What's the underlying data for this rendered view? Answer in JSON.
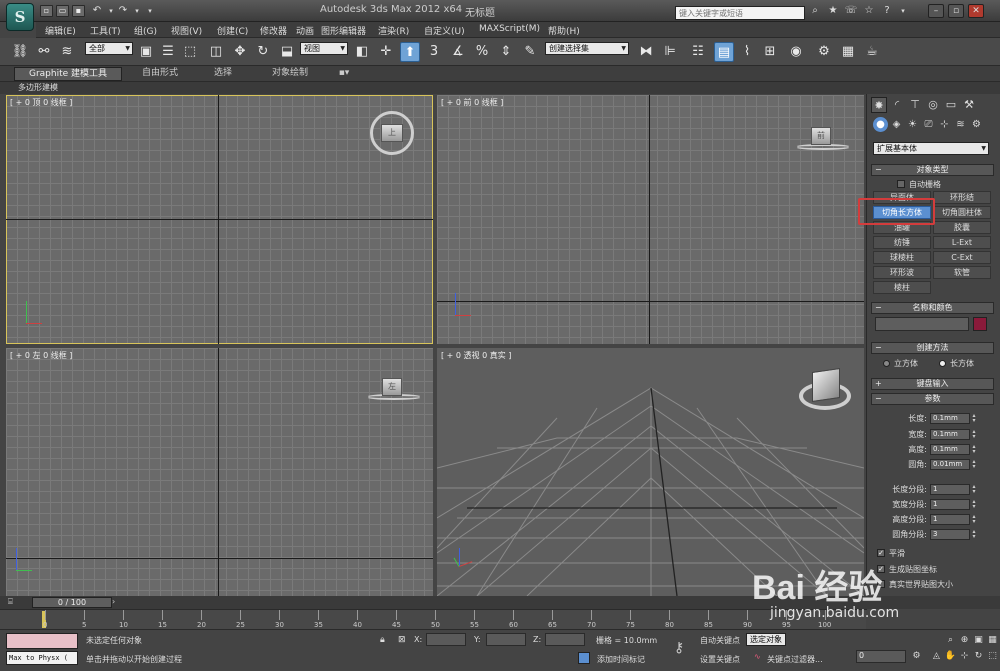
{
  "titlebar": {
    "app_title": "Autodesk 3ds Max  2012 x64",
    "doc_name": "无标题",
    "search_placeholder": "键入关键字或短语",
    "logo_icon": "3dsmax-logo-icon"
  },
  "menubar": {
    "items": [
      "编辑(E)",
      "工具(T)",
      "组(G)",
      "视图(V)",
      "创建(C)",
      "修改器",
      "动画",
      "图形编辑器",
      "渲染(R)",
      "自定义(U)",
      "MAXScript(M)",
      "帮助(H)"
    ]
  },
  "toolbar": {
    "selection_filter": "全部",
    "ref_coord": "视图",
    "snap_label": "3",
    "named_selection": "创建选择集"
  },
  "ribbon": {
    "tabs": [
      "Graphite 建模工具",
      "自由形式",
      "选择",
      "对象绘制"
    ],
    "sub_label": "多边形建模"
  },
  "viewports": {
    "top": {
      "label": "[ + 0 顶 0 线框 ]",
      "cube_label": "上"
    },
    "front": {
      "label": "[ + 0 前 0 线框 ]",
      "cube_label": "前"
    },
    "left": {
      "label": "[ + 0 左 0 线框 ]",
      "cube_label": "左"
    },
    "persp": {
      "label": "[ + 0 透视 0 真实 ]"
    }
  },
  "command_panel": {
    "category": "扩展基本体",
    "object_type": {
      "title": "对象类型",
      "autogrid": "自动栅格",
      "buttons": [
        "异面体",
        "环形结",
        "切角长方体",
        "切角圆柱体",
        "油罐",
        "胶囊",
        "纺锤",
        "L-Ext",
        "球棱柱",
        "C-Ext",
        "环形波",
        "软管",
        "棱柱"
      ],
      "selected": "切角长方体"
    },
    "name_color": {
      "title": "名称和颜色",
      "swatch": "#8a1a3a"
    },
    "creation_method": {
      "title": "创建方法",
      "options": [
        "立方体",
        "长方体"
      ],
      "selected": "长方体"
    },
    "keyboard_entry": {
      "title": "键盘输入"
    },
    "parameters": {
      "title": "参数",
      "fields": [
        {
          "label": "长度:",
          "value": "0.1mm"
        },
        {
          "label": "宽度:",
          "value": "0.1mm"
        },
        {
          "label": "高度:",
          "value": "0.1mm"
        },
        {
          "label": "圆角:",
          "value": "0.01mm"
        }
      ],
      "segs": [
        {
          "label": "长度分段:",
          "value": "1"
        },
        {
          "label": "宽度分段:",
          "value": "1"
        },
        {
          "label": "高度分段:",
          "value": "1"
        },
        {
          "label": "圆角分段:",
          "value": "3"
        }
      ],
      "smooth": "平滑",
      "gen_map": "生成贴图坐标",
      "real_world": "真实世界贴图大小"
    }
  },
  "timeline": {
    "frame": "0 / 100",
    "ticks": [
      "0",
      "5",
      "10",
      "15",
      "20",
      "25",
      "30",
      "35",
      "40",
      "45",
      "50",
      "55",
      "60",
      "65",
      "70",
      "75",
      "80",
      "85",
      "90",
      "95",
      "100"
    ]
  },
  "status": {
    "script_label": "Max to Physx (",
    "selection": "未选定任何对象",
    "prompt": "单击并拖动以开始创建过程",
    "x_label": "X:",
    "y_label": "Y:",
    "z_label": "Z:",
    "grid": "栅格 = 10.0mm",
    "add_time_tag": "添加时间标记",
    "auto_key": "自动关键点",
    "set_key": "设置关键点",
    "selected_dd": "选定对象",
    "key_filters": "关键点过滤器...",
    "frame_value": "0"
  },
  "watermark": {
    "text": "Bai 经验",
    "url": "jingyan.baidu.com"
  }
}
